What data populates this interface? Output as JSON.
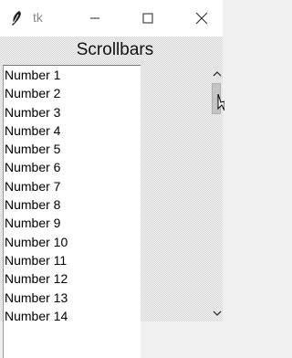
{
  "window": {
    "title": "tk",
    "icon": "feather-icon",
    "controls": [
      "minimize-icon",
      "maximize-icon",
      "close-icon"
    ]
  },
  "heading": "Scrollbars",
  "list": {
    "items": [
      "Number 1",
      "Number 2",
      "Number 3",
      "Number 4",
      "Number 5",
      "Number 6",
      "Number 7",
      "Number 8",
      "Number 9",
      "Number 10",
      "Number 11",
      "Number 12",
      "Number 13",
      "Number 14"
    ]
  },
  "scrollbar": {
    "icons": [
      "chevron-up-icon",
      "chevron-down-icon"
    ]
  }
}
